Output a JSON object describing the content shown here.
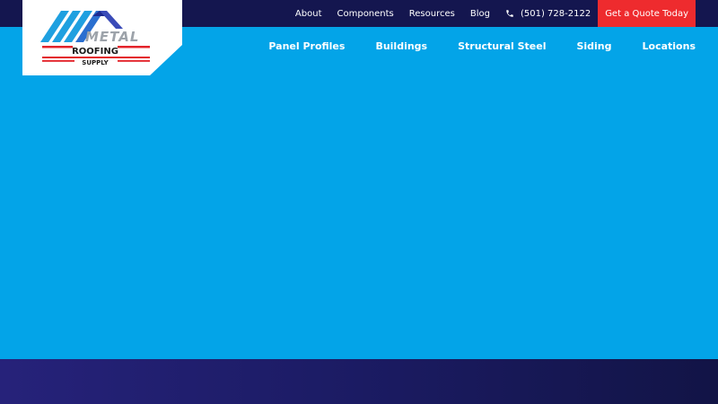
{
  "colors": {
    "topbar": "#14164f",
    "hero": "#03a4e8",
    "quote_button": "#ee2b2e",
    "logo_blue": "#1fa0e0",
    "logo_red": "#e3232a"
  },
  "logo": {
    "line1": "METAL",
    "line2": "ROOFING",
    "line3": "SUPPLY"
  },
  "top_nav": {
    "links": [
      "About",
      "Components",
      "Resources",
      "Blog"
    ],
    "phone": "(501) 728-2122",
    "phone_icon": "phone-icon",
    "quote_button": "Get a Quote Today"
  },
  "main_nav": {
    "items": [
      "Panel Profiles",
      "Buildings",
      "Structural Steel",
      "Siding",
      "Locations"
    ]
  }
}
